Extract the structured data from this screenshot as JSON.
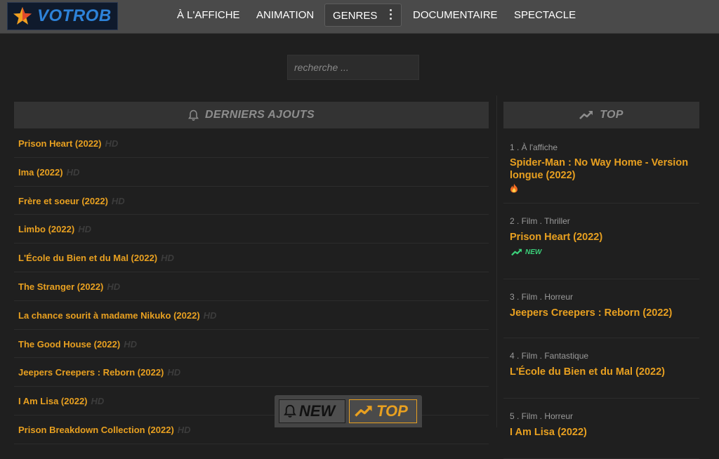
{
  "brand": {
    "name": "VOTROB"
  },
  "nav": {
    "items": [
      "À L'AFFICHE",
      "ANIMATION",
      "DOCUMENTAIRE",
      "SPECTACLE"
    ],
    "genres_label": "GENRES"
  },
  "search": {
    "placeholder": "recherche ..."
  },
  "latest": {
    "title": "DERNIERS AJOUTS",
    "quality_tag": "HD",
    "items": [
      "Prison Heart (2022)",
      "Ima (2022)",
      "Frère et soeur (2022)",
      "Limbo (2022)",
      "L'École du Bien et du Mal (2022)",
      "The Stranger (2022)",
      "La chance sourit à madame Nikuko (2022)",
      "The Good House (2022)",
      "Jeepers Creepers : Reborn (2022)",
      "I Am Lisa (2022)",
      "Prison Breakdown Collection (2022)"
    ]
  },
  "top": {
    "title": "TOP",
    "items": [
      {
        "meta": "1 . À l'affiche",
        "title": "Spider-Man : No Way Home - Version longue (2022)",
        "badge": "fire"
      },
      {
        "meta": "2 . Film . Thriller",
        "title": "Prison Heart (2022)",
        "badge": "NEW"
      },
      {
        "meta": "3 . Film . Horreur",
        "title": "Jeepers Creepers : Reborn (2022)",
        "badge": ""
      },
      {
        "meta": "4 . Film . Fantastique",
        "title": "L'École du Bien et du Mal (2022)",
        "badge": ""
      },
      {
        "meta": "5 . Film . Horreur",
        "title": "I Am Lisa (2022)",
        "badge": ""
      }
    ]
  },
  "float_bar": {
    "new_label": "NEW",
    "top_label": "TOP"
  },
  "colors": {
    "accent": "#e8a020",
    "new_green": "#3bd07a",
    "logo_blue": "#2d82d8"
  }
}
